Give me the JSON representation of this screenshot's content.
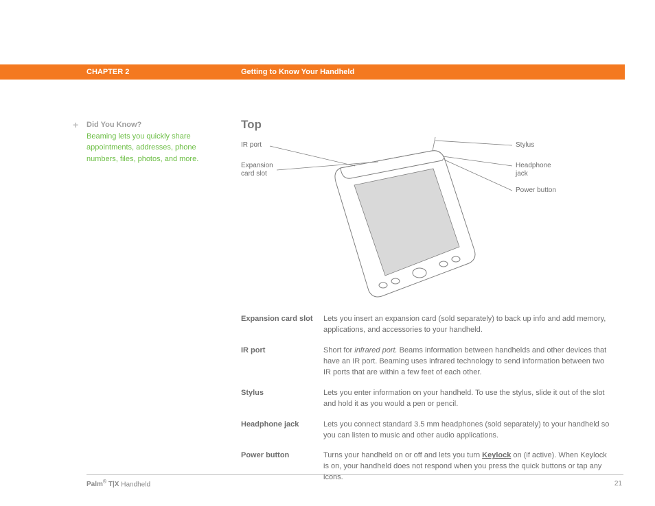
{
  "header": {
    "chapter": "CHAPTER 2",
    "title": "Getting to Know Your Handheld"
  },
  "sidebar": {
    "heading": "Did You Know?",
    "body": "Beaming lets you quickly share appointments, addresses, phone numbers, files, photos, and more."
  },
  "section_title": "Top",
  "callouts": {
    "ir_port": "IR port",
    "expansion_slot_l1": "Expansion",
    "expansion_slot_l2": "card slot",
    "stylus": "Stylus",
    "headphone_l1": "Headphone",
    "headphone_l2": "jack",
    "power_button": "Power button"
  },
  "definitions": [
    {
      "term": "Expansion card slot",
      "desc": "Lets you insert an expansion card (sold separately) to back up info and add memory, applications, and accessories to your handheld."
    },
    {
      "term": "IR port",
      "desc_pre": "Short for ",
      "desc_em": "infrared port.",
      "desc_post": " Beams information between handhelds and other devices that have an IR port. Beaming uses infrared technology to send information between two IR ports that are within a few feet of each other."
    },
    {
      "term": "Stylus",
      "desc": "Lets you enter information on your handheld. To use the stylus, slide it out of the slot and hold it as you would a pen or pencil."
    },
    {
      "term": "Headphone jack",
      "desc": "Lets you connect standard 3.5 mm headphones (sold separately) to your handheld so you can listen to music and other audio applications."
    },
    {
      "term": "Power button",
      "desc_pre": "Turns your handheld on or off and lets you turn ",
      "desc_link": "Keylock",
      "desc_post": " on (if active). When Keylock is on, your handheld does not respond when you press the quick buttons or tap any icons."
    }
  ],
  "footer": {
    "brand": "Palm",
    "model": "T|X",
    "suffix": "Handheld",
    "page": "21"
  }
}
